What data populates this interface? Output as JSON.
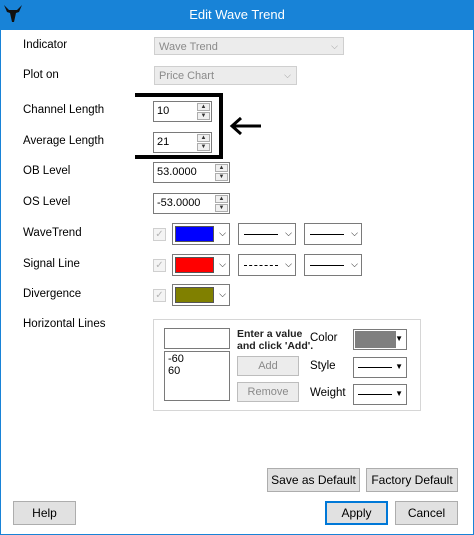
{
  "window": {
    "title": "Edit Wave Trend",
    "accent": "#1883d7"
  },
  "labels": {
    "indicator": "Indicator",
    "plot_on": "Plot on",
    "channel_length": "Channel Length",
    "average_length": "Average Length",
    "ob_level": "OB Level",
    "os_level": "OS Level",
    "wavetrend": "WaveTrend",
    "signal_line": "Signal Line",
    "divergence": "Divergence",
    "horizontal_lines": "Horizontal Lines"
  },
  "fields": {
    "indicator": "Wave Trend",
    "plot_on": "Price Chart",
    "channel_length": "10",
    "average_length": "21",
    "ob_level": "53.0000",
    "os_level": "-53.0000"
  },
  "plots": {
    "wavetrend": {
      "color": "#0000ff",
      "checked": true
    },
    "signal_line": {
      "color": "#ff0000",
      "checked": true
    },
    "divergence": {
      "color": "#808000",
      "checked": true
    }
  },
  "horizontal_lines": {
    "input_value": "",
    "note_line1": "Enter a value",
    "note_line2": "and click 'Add'.",
    "items": [
      "-60",
      "60"
    ],
    "add_label": "Add",
    "remove_label": "Remove",
    "color_label": "Color",
    "style_label": "Style",
    "weight_label": "Weight",
    "line_color": "#7f7f7f"
  },
  "buttons": {
    "save_default": "Save as Default",
    "factory_default": "Factory Default",
    "help": "Help",
    "apply": "Apply",
    "cancel": "Cancel"
  },
  "icons": {
    "app": "bull-logo-icon",
    "dropdown": "chevron-down-icon",
    "check": "check-icon",
    "annotation": "arrow-left-icon"
  }
}
